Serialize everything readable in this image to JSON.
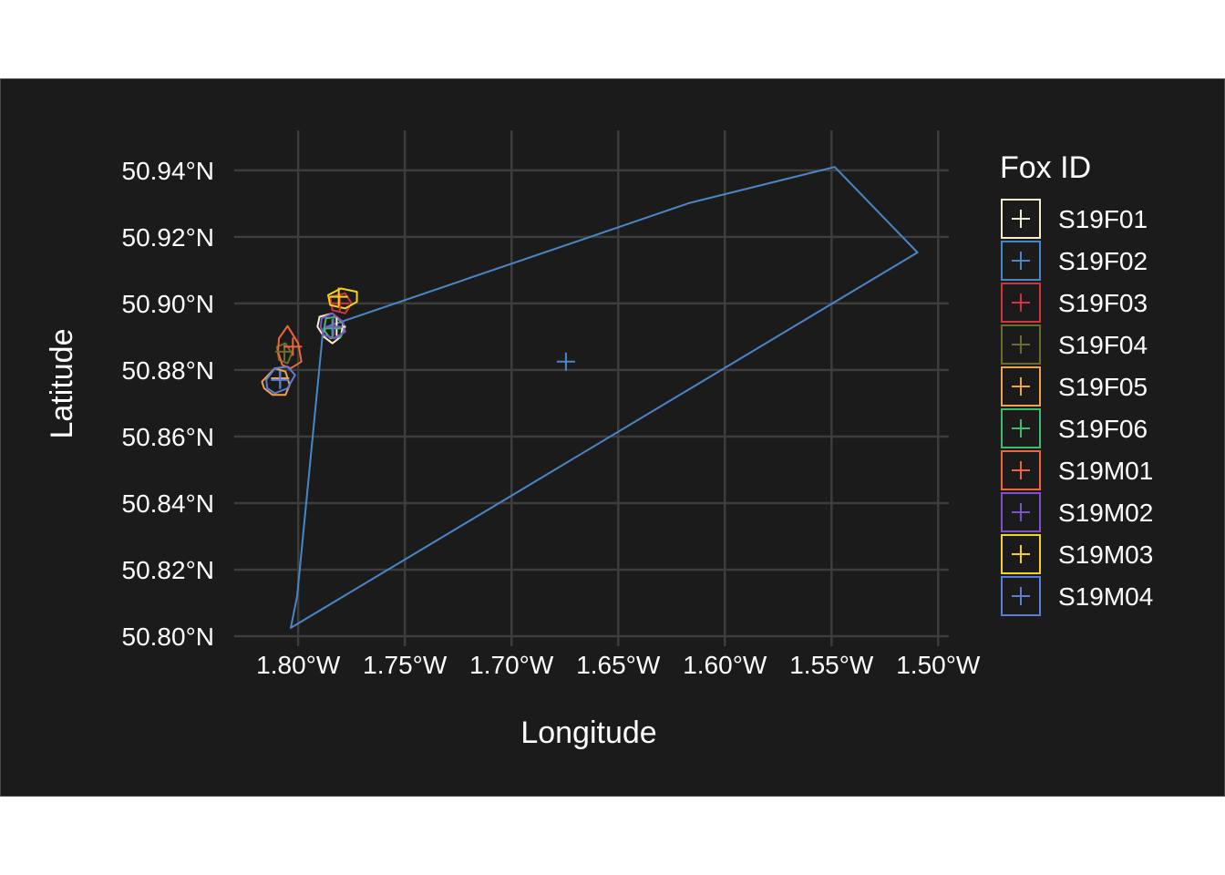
{
  "chart_data": {
    "type": "map",
    "title": "",
    "xlabel": "Longitude",
    "ylabel": "Latitude",
    "xlim": [
      -1.83,
      -1.495
    ],
    "ylim": [
      50.797,
      50.952
    ],
    "grid": true,
    "x_ticks": [
      {
        "value": -1.8,
        "label": "1.80°W"
      },
      {
        "value": -1.75,
        "label": "1.75°W"
      },
      {
        "value": -1.7,
        "label": "1.70°W"
      },
      {
        "value": -1.65,
        "label": "1.65°W"
      },
      {
        "value": -1.6,
        "label": "1.60°W"
      },
      {
        "value": -1.55,
        "label": "1.55°W"
      },
      {
        "value": -1.5,
        "label": "1.50°W"
      }
    ],
    "y_ticks": [
      {
        "value": 50.94,
        "label": "50.94°N"
      },
      {
        "value": 50.92,
        "label": "50.92°N"
      },
      {
        "value": 50.9,
        "label": "50.90°N"
      },
      {
        "value": 50.88,
        "label": "50.88°N"
      },
      {
        "value": 50.86,
        "label": "50.86°N"
      },
      {
        "value": 50.84,
        "label": "50.84°N"
      },
      {
        "value": 50.82,
        "label": "50.82°N"
      },
      {
        "value": 50.8,
        "label": "50.80°N"
      }
    ],
    "legend": {
      "title": "Fox ID",
      "position": "right"
    },
    "series": [
      {
        "name": "S19F01",
        "color": "#f8efc9",
        "centroid": [
          -1.782,
          50.893
        ],
        "polygon": [
          [
            -1.79,
            50.896
          ],
          [
            -1.784,
            50.897
          ],
          [
            -1.779,
            50.894
          ],
          [
            -1.78,
            50.89
          ],
          [
            -1.784,
            50.888
          ],
          [
            -1.788,
            50.89
          ],
          [
            -1.791,
            50.893
          ]
        ]
      },
      {
        "name": "S19F02",
        "color": "#4a86c6",
        "centroid": [
          -1.6745,
          50.8825
        ],
        "polygon": [
          [
            -1.7865,
            50.893
          ],
          [
            -1.6165,
            50.9302
          ],
          [
            -1.5485,
            50.941
          ],
          [
            -1.5097,
            50.9153
          ],
          [
            -1.8035,
            50.8025
          ],
          [
            -1.8005,
            50.812
          ],
          [
            -1.7885,
            50.891
          ]
        ]
      },
      {
        "name": "S19F03",
        "color": "#d1343c",
        "centroid": [
          -1.7805,
          50.9
        ],
        "polygon": [
          [
            -1.785,
            50.902
          ],
          [
            -1.778,
            50.903
          ],
          [
            -1.775,
            50.9
          ],
          [
            -1.778,
            50.897
          ],
          [
            -1.784,
            50.898
          ]
        ]
      },
      {
        "name": "S19F04",
        "color": "#6b6b2f",
        "centroid": [
          -1.8065,
          50.8855
        ],
        "polygon": [
          [
            -1.81,
            50.887
          ],
          [
            -1.806,
            50.888
          ],
          [
            -1.803,
            50.885
          ],
          [
            -1.805,
            50.882
          ],
          [
            -1.809,
            50.883
          ]
        ]
      },
      {
        "name": "S19F05",
        "color": "#f2a24a",
        "centroid": [
          -1.8085,
          50.8775
        ],
        "polygon": [
          [
            -1.817,
            50.8765
          ],
          [
            -1.811,
            50.8805
          ],
          [
            -1.806,
            50.8795
          ],
          [
            -1.804,
            50.8755
          ],
          [
            -1.806,
            50.8725
          ],
          [
            -1.812,
            50.8725
          ],
          [
            -1.816,
            50.8745
          ]
        ]
      },
      {
        "name": "S19F06",
        "color": "#3dbb6e",
        "centroid": [
          -1.784,
          50.8925
        ],
        "polygon": [
          [
            -1.787,
            50.8955
          ],
          [
            -1.782,
            50.896
          ],
          [
            -1.778,
            50.893
          ],
          [
            -1.78,
            50.89
          ],
          [
            -1.785,
            50.8895
          ],
          [
            -1.788,
            50.892
          ]
        ]
      },
      {
        "name": "S19M01",
        "color": "#f0663c",
        "centroid": [
          -1.8025,
          50.887
        ],
        "polygon": [
          [
            -1.809,
            50.8895
          ],
          [
            -1.805,
            50.8932
          ],
          [
            -1.8,
            50.888
          ],
          [
            -1.7985,
            50.8825
          ],
          [
            -1.8035,
            50.8805
          ],
          [
            -1.8075,
            50.8815
          ],
          [
            -1.8095,
            50.8855
          ]
        ]
      },
      {
        "name": "S19M02",
        "color": "#8052c6",
        "centroid": [
          -1.7835,
          50.893
        ],
        "polygon": [
          [
            -1.789,
            50.8955
          ],
          [
            -1.784,
            50.897
          ],
          [
            -1.779,
            50.8945
          ],
          [
            -1.778,
            50.8915
          ],
          [
            -1.783,
            50.8895
          ],
          [
            -1.788,
            50.8905
          ],
          [
            -1.7895,
            50.893
          ]
        ]
      },
      {
        "name": "S19M03",
        "color": "#f6d21c",
        "centroid": [
          -1.781,
          50.902
        ],
        "polygon": [
          [
            -1.786,
            50.9025
          ],
          [
            -1.78,
            50.9045
          ],
          [
            -1.7725,
            50.9035
          ],
          [
            -1.7725,
            50.9005
          ],
          [
            -1.778,
            50.8985
          ],
          [
            -1.785,
            50.8995
          ]
        ]
      },
      {
        "name": "S19M04",
        "color": "#5b7fd8",
        "centroid": [
          -1.8085,
          50.877
        ],
        "polygon": [
          [
            -1.815,
            50.877
          ],
          [
            -1.811,
            50.8805
          ],
          [
            -1.805,
            50.881
          ],
          [
            -1.8015,
            50.8785
          ],
          [
            -1.805,
            50.8745
          ],
          [
            -1.811,
            50.873
          ],
          [
            -1.8145,
            50.8745
          ]
        ]
      }
    ]
  }
}
